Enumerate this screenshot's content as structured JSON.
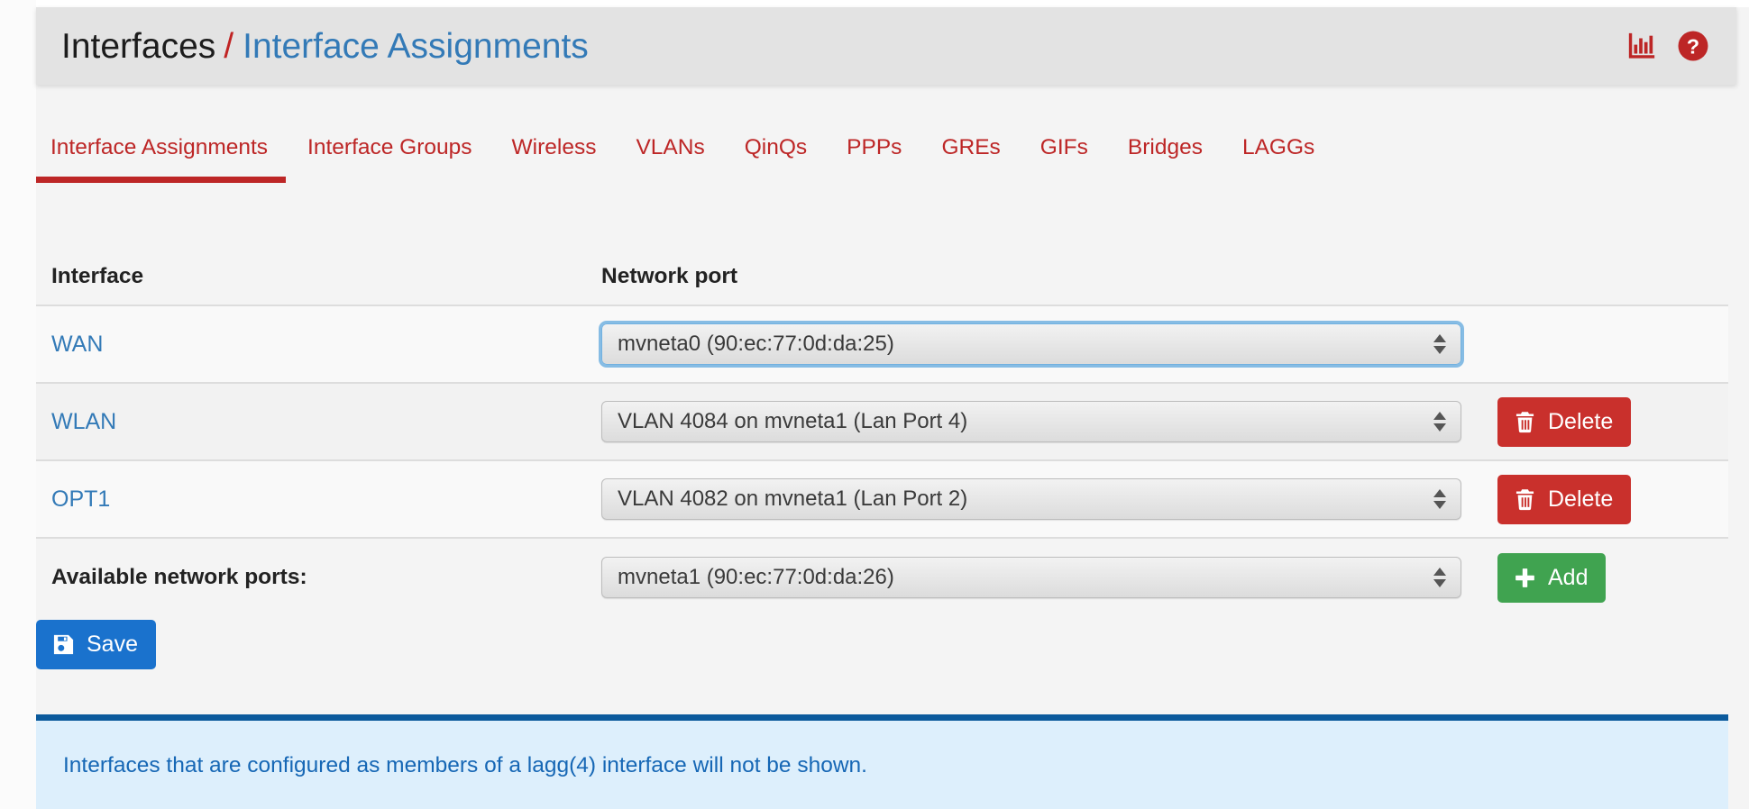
{
  "header": {
    "breadcrumb_root": "Interfaces",
    "breadcrumb_separator": "/",
    "breadcrumb_current": "Interface Assignments",
    "icons": [
      {
        "name": "status-chart-icon",
        "label": "Status Monitoring"
      },
      {
        "name": "help-icon",
        "label": "Help"
      }
    ],
    "icon_color": "#bd2626"
  },
  "tabs": [
    {
      "label": "Interface Assignments",
      "active": true
    },
    {
      "label": "Interface Groups",
      "active": false
    },
    {
      "label": "Wireless",
      "active": false
    },
    {
      "label": "VLANs",
      "active": false
    },
    {
      "label": "QinQs",
      "active": false
    },
    {
      "label": "PPPs",
      "active": false
    },
    {
      "label": "GREs",
      "active": false
    },
    {
      "label": "GIFs",
      "active": false
    },
    {
      "label": "Bridges",
      "active": false
    },
    {
      "label": "LAGGs",
      "active": false
    }
  ],
  "table": {
    "columns": {
      "interface": "Interface",
      "network_port": "Network port"
    },
    "rows": [
      {
        "interface": "WAN",
        "port_value": "mvneta0 (90:ec:77:0d:da:25)",
        "focused": true,
        "action": null
      },
      {
        "interface": "WLAN",
        "port_value": "VLAN 4084 on mvneta1 (Lan Port 4)",
        "focused": false,
        "action": "Delete"
      },
      {
        "interface": "OPT1",
        "port_value": "VLAN 4082 on mvneta1 (Lan Port 2)",
        "focused": false,
        "action": "Delete"
      }
    ],
    "available": {
      "label": "Available network ports:",
      "port_value": "mvneta1 (90:ec:77:0d:da:26)",
      "action": "Add"
    }
  },
  "buttons": {
    "save": "Save",
    "delete": "Delete",
    "add": "Add"
  },
  "colors": {
    "accent_red": "#bd2626",
    "link_blue": "#337ab7",
    "danger": "#c9302c",
    "success": "#40a350",
    "primary": "#1a72cd",
    "info_border": "#0b5a9c",
    "info_bg": "#ddeffc",
    "info_text": "#1667b5"
  },
  "info": {
    "message": "Interfaces that are configured as members of a lagg(4) interface will not be shown."
  }
}
